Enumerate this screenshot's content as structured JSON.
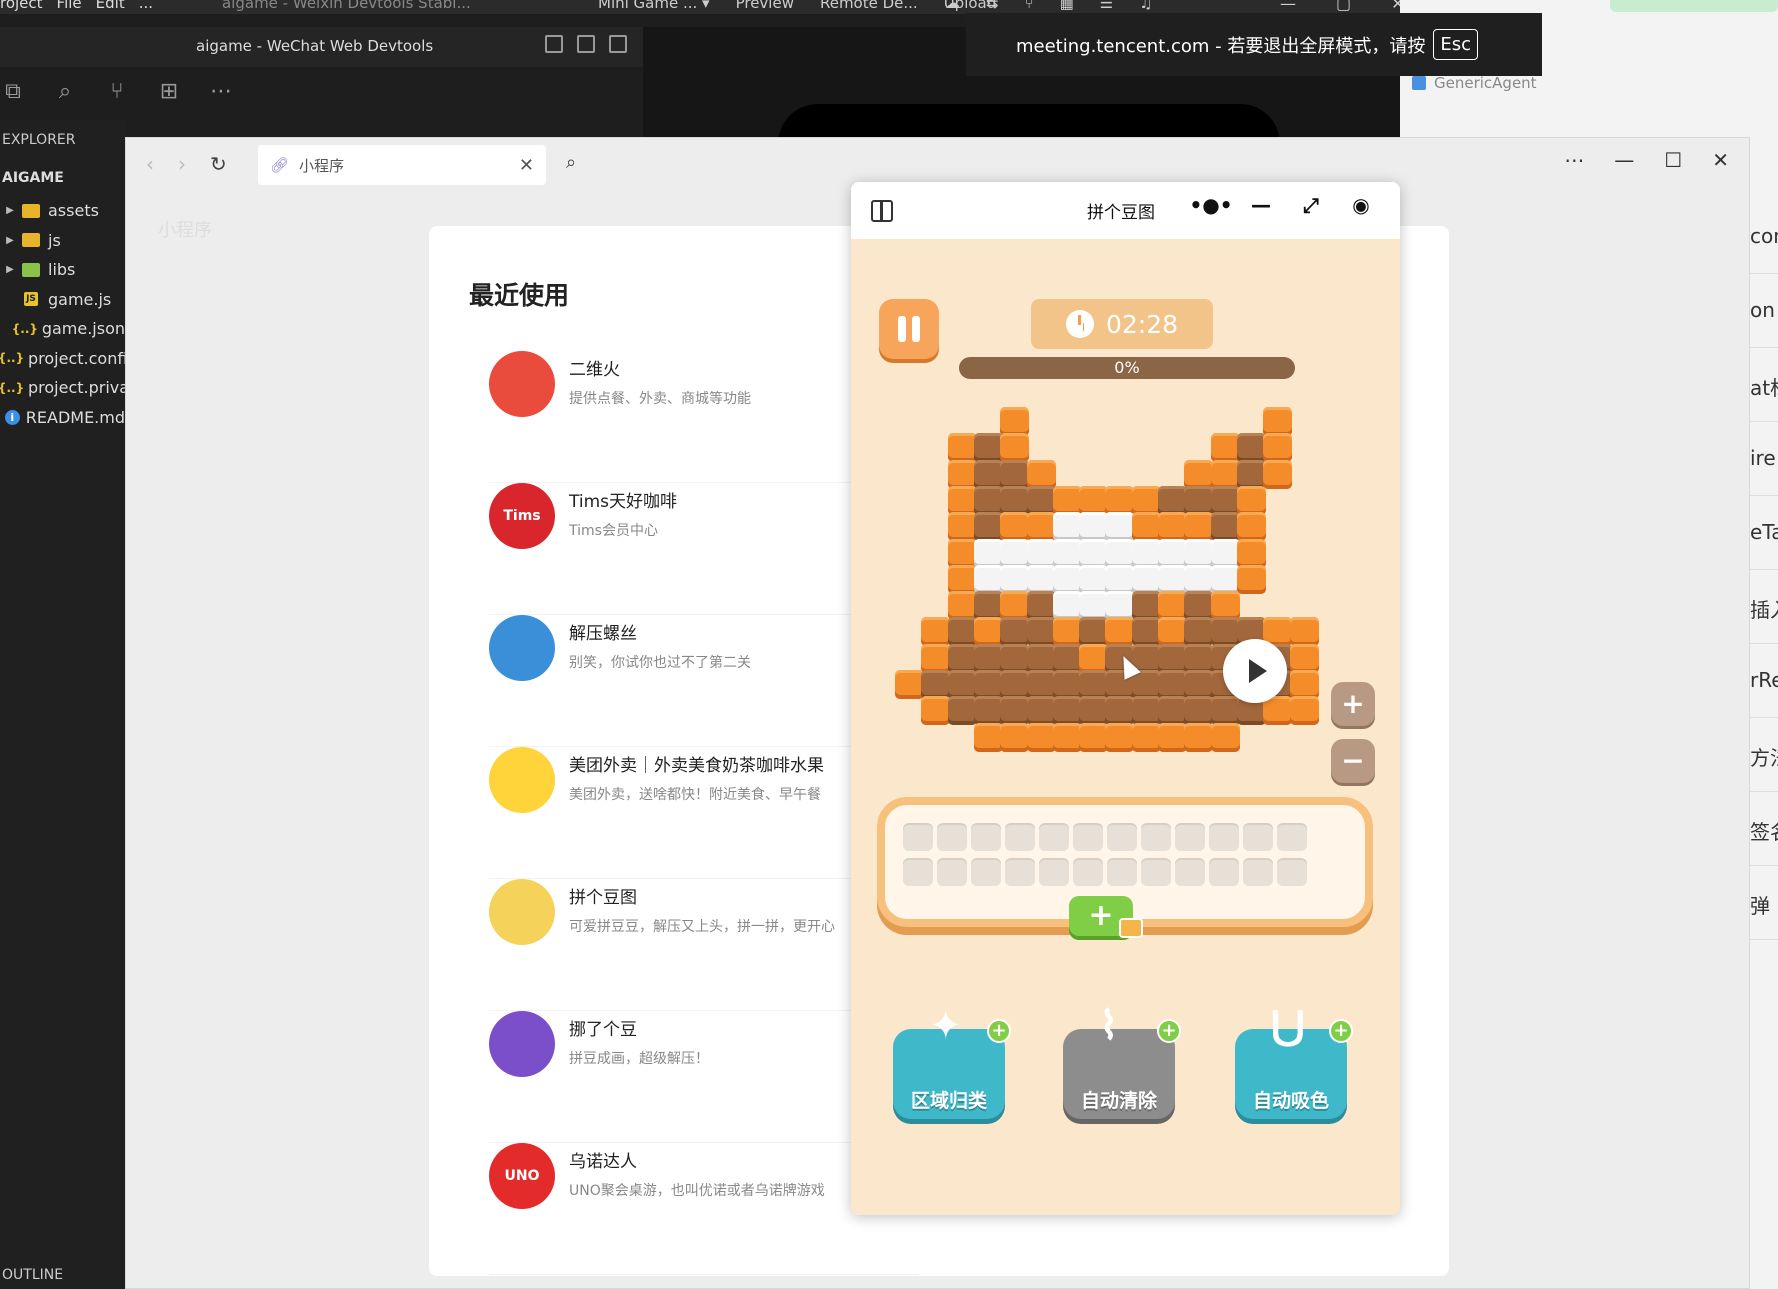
{
  "topbar": {
    "menu": [
      "roject",
      "File",
      "Edit",
      "..."
    ],
    "title": "aigame - Weixin Devtools Stabl...",
    "items": [
      "Mini Game ... ▾",
      "Preview",
      "Remote De...",
      "Upload"
    ]
  },
  "devtools_title": "aigame - WeChat Web Devtools",
  "meeting": {
    "text": "meeting.tencent.com - 若要退出全屏模式，请按",
    "key": "Esc"
  },
  "generic_agent": "GenericAgent",
  "side_list": [
    "con",
    "on",
    "at标",
    "ire",
    "eTa",
    "插入",
    "rRe",
    "方法",
    "签名",
    "弹"
  ],
  "explorer": {
    "header": "EXPLORER",
    "project": "AIGAME",
    "items": [
      {
        "label": "assets",
        "type": "folder"
      },
      {
        "label": "js",
        "type": "folder"
      },
      {
        "label": "libs",
        "type": "folder-green"
      },
      {
        "label": "game.js",
        "type": "js"
      },
      {
        "label": "game.json",
        "type": "json"
      },
      {
        "label": "project.config.json",
        "type": "json"
      },
      {
        "label": "project.private.config.json",
        "type": "json"
      },
      {
        "label": "README.md",
        "type": "info"
      }
    ],
    "outline": "OUTLINE"
  },
  "window": {
    "address": "小程序",
    "bg_label": "小程序"
  },
  "recent": {
    "heading": "最近使用",
    "apps": [
      {
        "name": "二维火",
        "desc": "提供点餐、外卖、商城等功能",
        "color": "#e94b3c",
        "badge": ""
      },
      {
        "name": "Tims天好咖啡",
        "desc": "Tims会员中心",
        "color": "#d8262c",
        "badge": "Tims"
      },
      {
        "name": "解压螺丝",
        "desc": "别笑，你试你也过不了第二关",
        "color": "#3b8fd8",
        "badge": ""
      },
      {
        "name": "美团外卖｜外卖美食奶茶咖啡水果",
        "desc": "美团外卖，送啥都快！附近美食、早午餐",
        "color": "#ffd43b",
        "badge": ""
      },
      {
        "name": "拼个豆图",
        "desc": "可爱拼豆豆，解压又上头，拼一拼，更开心",
        "color": "#f5d35b",
        "badge": ""
      },
      {
        "name": "挪了个豆",
        "desc": "拼豆成画，超级解压！",
        "color": "#7a4fc9",
        "badge": ""
      },
      {
        "name": "乌诺达人",
        "desc": "UNO聚会桌游，也叫优诺或者乌诺牌游戏",
        "color": "#e32b2b",
        "badge": "UNO"
      }
    ]
  },
  "phone": {
    "title": "拼个豆图",
    "capsule": [
      "•●•",
      "—",
      "⤢",
      "◉"
    ],
    "timer": "02:28",
    "progress": {
      "label": "0%",
      "value": 0
    },
    "zoom_in": "+",
    "zoom_out": "−",
    "add_label": "+",
    "tools": [
      {
        "label": "区域归类",
        "icon": "magic-wand-icon"
      },
      {
        "label": "自动清除",
        "icon": "broom-icon"
      },
      {
        "label": "自动吸色",
        "icon": "magnet-icon"
      }
    ],
    "bead_pattern": [
      "....O.........O....",
      "..OBO.......OBO....",
      "..OBBO.....OOBO....",
      "..OBBBOOOOBBBO.....",
      "..OBOOWWWOOOBO.....",
      "..OWWWWWWWWWWO.....",
      "..OWWWWWWWWWWO.....",
      "..OBOBWWWBOBO......",
      ".OBOBBOBOBOBBBOO...",
      ".OBBBBBOBBBBBBBO...",
      "OBBBBBBBBBBBBBBO...",
      ".OBBBBBBBBBBBBOO...",
      "...OOOOOOOOOO......"
    ]
  }
}
